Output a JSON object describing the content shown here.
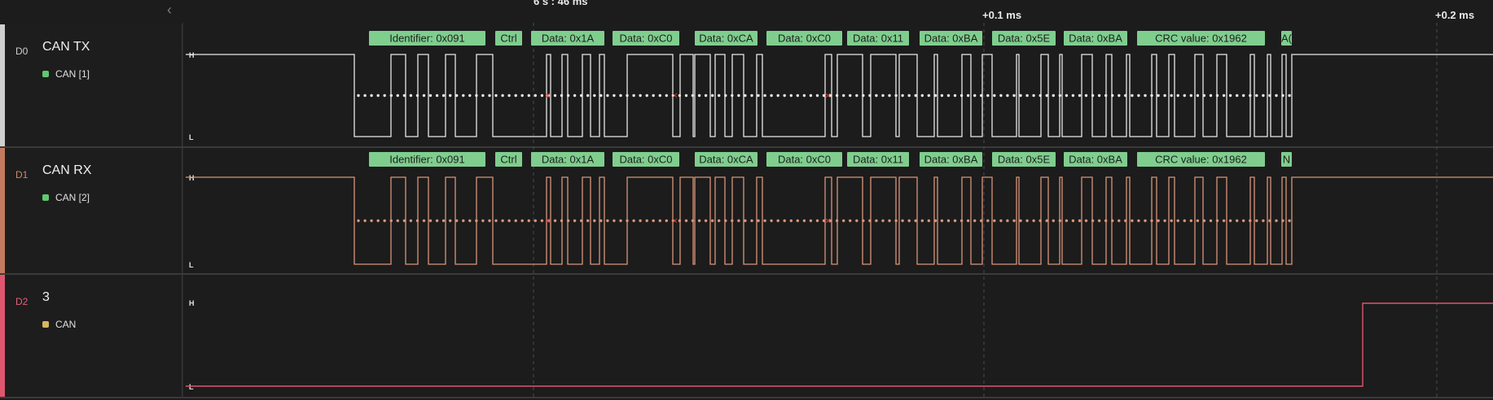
{
  "ruler": {
    "cursor_label": "6 s : 46 ms",
    "tick_labels": [
      "+0.1 ms",
      "+0.2 ms"
    ],
    "collapse_icon": "chevron-left-icon"
  },
  "colors": {
    "background": "#1c1c1c",
    "tx_trace": "#e8e8e8",
    "rx_trace": "#d9957a",
    "ch3_trace": "#e0556e",
    "frame_box": "#7fce8e",
    "frame_text": "#1e1e1e",
    "error_mark": "#e0403a",
    "analyzer_green": "#5fc870",
    "analyzer_yellow": "#d8b560"
  },
  "channels": [
    {
      "id": "D0",
      "name": "CAN TX",
      "analyzer": "CAN [1]",
      "bar_color": "#cfcfcf",
      "id_color": "#cfcfcf",
      "frames": [
        "Identifier: 0x091",
        "Ctrl",
        "Data: 0x1A",
        "Data: 0xC0",
        "Data: 0xCA",
        "Data: 0xC0",
        "Data: 0x11",
        "Data: 0xBA",
        "Data: 0x5E",
        "Data: 0xBA",
        "CRC value: 0x1962",
        "A("
      ]
    },
    {
      "id": "D1",
      "name": "CAN RX",
      "analyzer": "CAN [2]",
      "bar_color": "#c47a5e",
      "id_color": "#d4876a",
      "frames": [
        "Identifier: 0x091",
        "Ctrl",
        "Data: 0x1A",
        "Data: 0xC0",
        "Data: 0xCA",
        "Data: 0xC0",
        "Data: 0x11",
        "Data: 0xBA",
        "Data: 0x5E",
        "Data: 0xBA",
        "CRC value: 0x1962",
        "N"
      ]
    },
    {
      "id": "D2",
      "name": "3",
      "analyzer": "CAN",
      "bar_color": "#e0556e",
      "id_color": "#e8607a"
    }
  ],
  "level_labels": {
    "high": "H",
    "low": "L"
  }
}
